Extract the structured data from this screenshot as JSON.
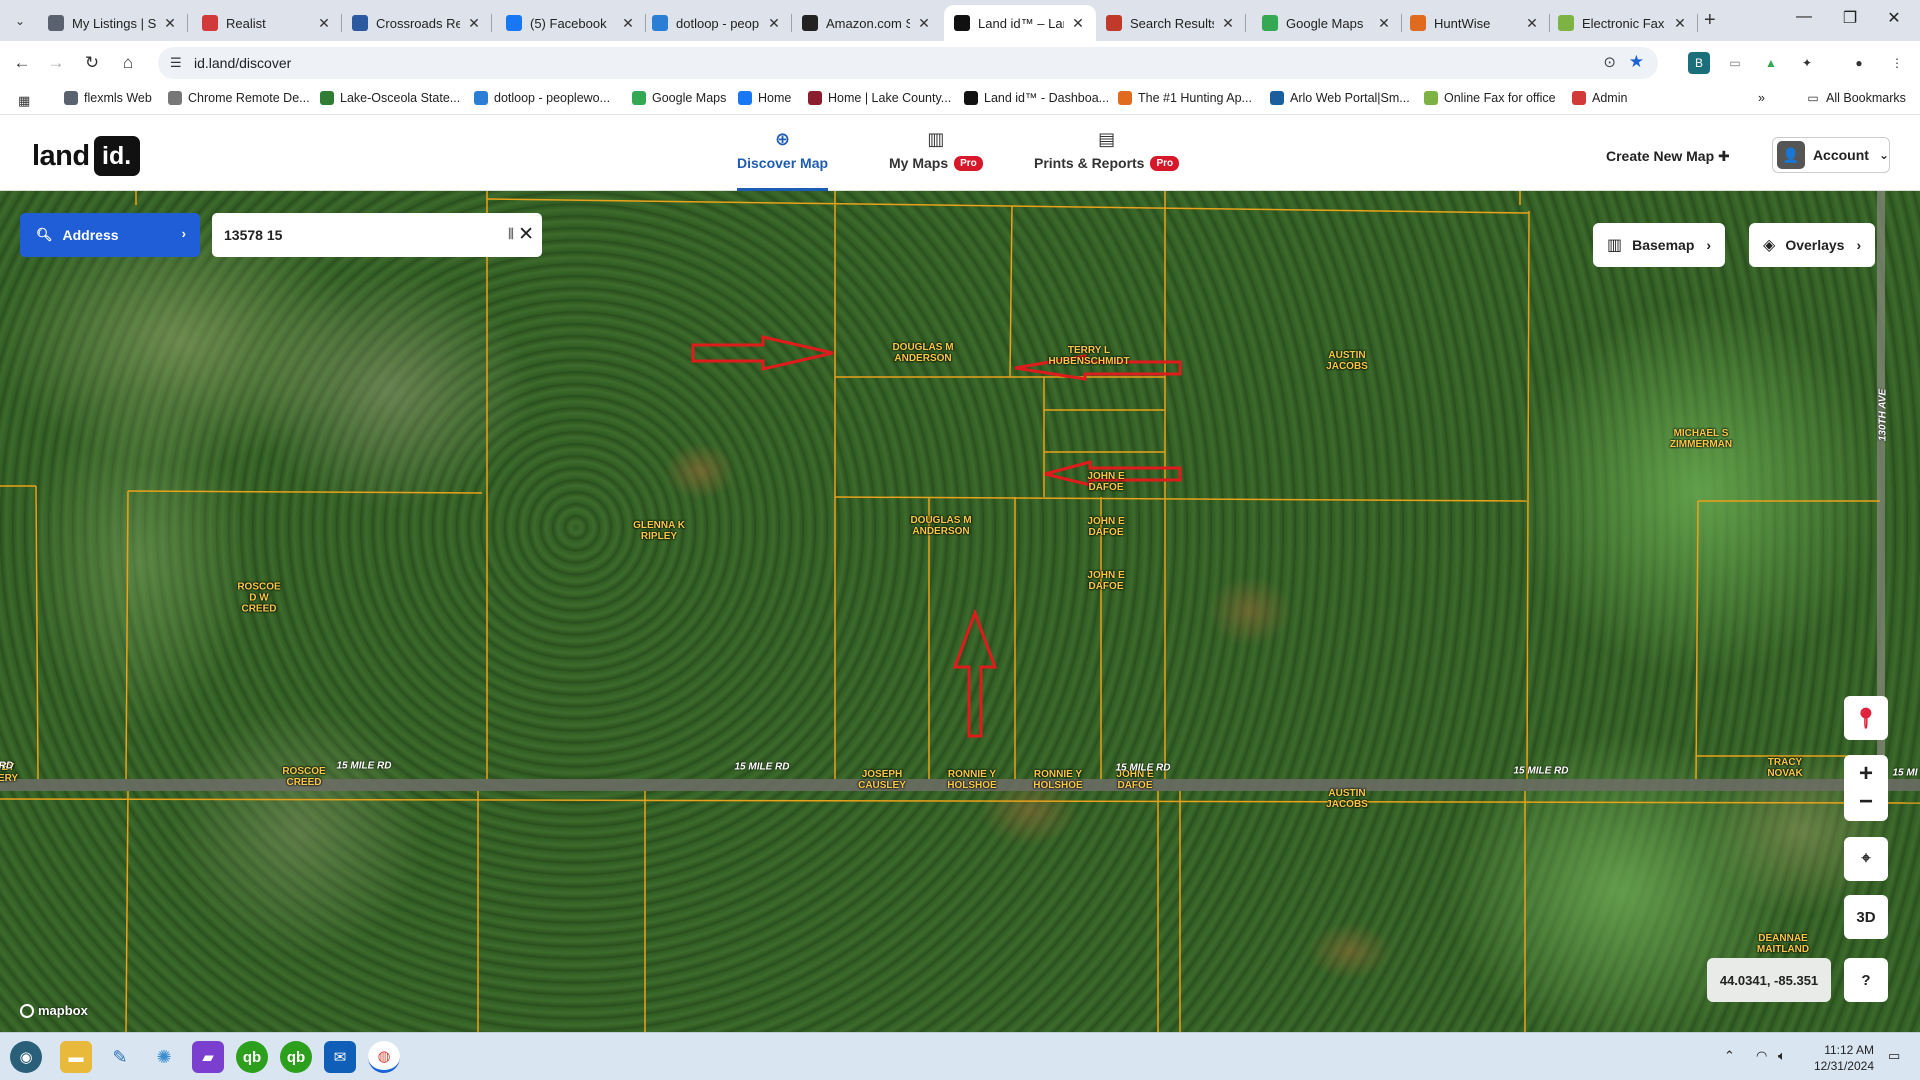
{
  "browser": {
    "tabs": [
      {
        "title": "My Listings | St",
        "icon": "flexmls-icon",
        "color": "#5a6270"
      },
      {
        "title": "Realist",
        "icon": "realist-icon",
        "color": "#d23a3a"
      },
      {
        "title": "Crossroads Rea",
        "icon": "crossroads-icon",
        "color": "#2c5aa0"
      },
      {
        "title": "(5) Facebook",
        "icon": "facebook-icon",
        "color": "#1877f2"
      },
      {
        "title": "dotloop - peop",
        "icon": "dotloop-icon",
        "color": "#2a7fd4"
      },
      {
        "title": "Amazon.com S",
        "icon": "amazon-icon",
        "color": "#222222"
      },
      {
        "title": "Land id™ – Lan",
        "icon": "landid-icon",
        "color": "#111111"
      },
      {
        "title": "Search Results",
        "icon": "search-results-icon",
        "color": "#c0392b"
      },
      {
        "title": "Google Maps",
        "icon": "google-maps-icon",
        "color": "#34a853"
      },
      {
        "title": "HuntWise",
        "icon": "huntwise-icon",
        "color": "#e06b1f"
      },
      {
        "title": "Electronic Fax (",
        "icon": "fax-icon",
        "color": "#7cb342"
      }
    ],
    "url": "id.land/discover",
    "bookmarks": [
      {
        "label": "flexmls Web",
        "color": "#5a6270"
      },
      {
        "label": "Chrome Remote De...",
        "color": "#777777"
      },
      {
        "label": "Lake-Osceola State...",
        "color": "#2e7d32"
      },
      {
        "label": "dotloop - peoplewo...",
        "color": "#2a7fd4"
      },
      {
        "label": "Google Maps",
        "color": "#34a853"
      },
      {
        "label": "Home",
        "color": "#1877f2"
      },
      {
        "label": "Home | Lake County...",
        "color": "#8b1e2d"
      },
      {
        "label": "Land id™ - Dashboa...",
        "color": "#111111"
      },
      {
        "label": "The #1 Hunting Ap...",
        "color": "#e06b1f"
      },
      {
        "label": "Arlo Web Portal|Sm...",
        "color": "#1b5e9e"
      },
      {
        "label": "Online Fax for office",
        "color": "#7cb342"
      },
      {
        "label": "Admin",
        "color": "#d23a3a"
      }
    ],
    "more_bookmarks": "»",
    "all_bookmarks": "All Bookmarks"
  },
  "app": {
    "logo_text": "land",
    "logo_box": "id.",
    "nav": [
      {
        "label": "Discover Map",
        "pro": false,
        "active": true
      },
      {
        "label": "My Maps",
        "pro": true,
        "active": false
      },
      {
        "label": "Prints & Reports",
        "pro": true,
        "active": false
      }
    ],
    "pro_label": "Pro",
    "create_map": "Create New Map",
    "account": "Account"
  },
  "map": {
    "search_type": "Address",
    "search_value": "13578 15",
    "basemap": "Basemap",
    "overlays": "Overlays",
    "three_d": "3D",
    "help": "?",
    "coords": "44.0341, -85.351",
    "attribution": "mapbox",
    "owners": [
      "DOUGLAS M\nANDERSON",
      "TERRY L\nHUBENSCHMIDT",
      "AUSTIN\nJACOBS",
      "MICHAEL S\nZIMMERMAN",
      "GLENNA K\nRIPLEY",
      "JOHN E\nDAFOE",
      "DOUGLAS M\nANDERSON",
      "JOHN E\nDAFOE",
      "JOHN E\nDAFOE",
      "ROSCOE\nD W\nCREED",
      "ROSCOE\nCREED",
      "JOSEPH\nCAUSLEY",
      "RONNIE Y\nHOLSHOE",
      "RONNIE Y\nHOLSHOE",
      "JOHN E\nDAFOE",
      "AUSTIN\nJACOBS",
      "TRACY\nNOVAK",
      "DEANNAE\nMAITLAND",
      "EY\nERY"
    ],
    "roads": [
      "15 MILE RD",
      "15 MILE RD",
      "15 MILE RD",
      "15 MILE RD",
      "RD",
      "130TH AVE",
      "15 MI"
    ]
  },
  "taskbar": {
    "time": "11:12 AM",
    "date": "12/31/2024"
  }
}
